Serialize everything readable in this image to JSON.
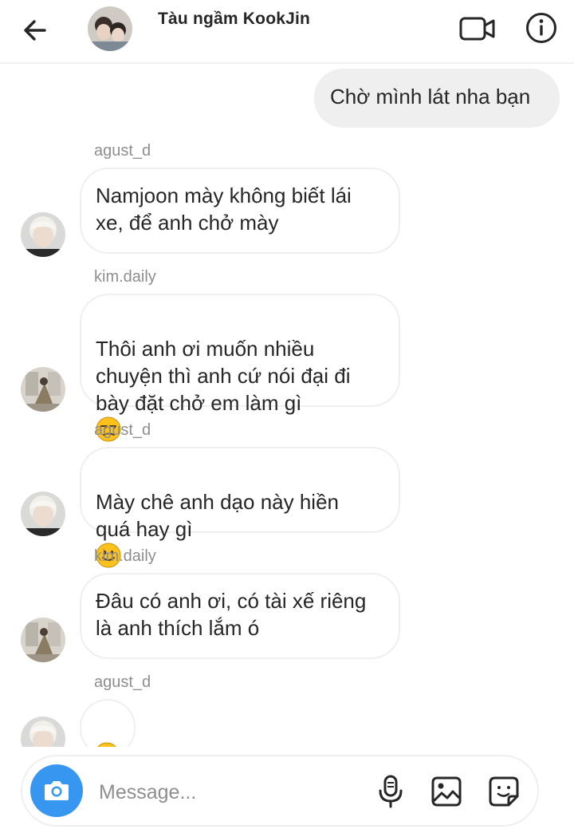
{
  "header": {
    "title": "Tàu ngầm KookJin",
    "back_icon": "arrow-left-icon",
    "video_icon": "video-call-icon",
    "info_icon": "info-icon"
  },
  "thread": {
    "messages": [
      {
        "type": "outgoing",
        "text": "Chờ mình lát nha bạn"
      },
      {
        "type": "incoming",
        "sender": "agust_d",
        "text": "Namjoon mày không biết lái\nxe, để anh chở mày"
      },
      {
        "type": "incoming",
        "sender": "kim.daily",
        "text": "Thôi anh ơi muốn nhiều\nchuyện thì anh cứ nói đại đi\nbày đặt chở em làm gì",
        "emoji": "unamused-face-emoji"
      },
      {
        "type": "incoming",
        "sender": "agust_d",
        "text": "Mày chê anh dạo này hiền\nquá hay gì",
        "emoji": "slightly-smiling-face-emoji"
      },
      {
        "type": "incoming",
        "sender": "kim.daily",
        "text": "Đâu có anh ơi, có tài xế riêng\nlà anh thích lắm ó"
      },
      {
        "type": "incoming",
        "sender": "agust_d",
        "emoji": "slightly-smiling-face-emoji"
      }
    ]
  },
  "composer": {
    "placeholder": "Message...",
    "camera_icon": "camera-icon",
    "mic_icon": "microphone-icon",
    "gallery_icon": "gallery-icon",
    "sticker_icon": "sticker-icon"
  },
  "colors": {
    "accent": "#3797f0",
    "outgoing_bubble": "#efefef",
    "border": "#efefef",
    "secondary_text": "#8e8e8e"
  }
}
